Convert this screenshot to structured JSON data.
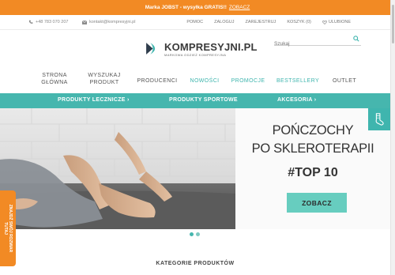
{
  "promo": {
    "text": "Marka JOBST - wysyłka GRATIS!!",
    "link": "ZOBACZ"
  },
  "util": {
    "phone": "+48 783 070 207",
    "email": "kontakt@kompresyjni.pl",
    "links": [
      "POMOC",
      "ZALOGUJ",
      "ZAREJESTRUJ",
      "KOSZYK (0)",
      "ULUBIONE"
    ]
  },
  "logo": {
    "name": "KOMPRESYJNI.PL",
    "tagline": "MARKOWA ODZIEŻ KOMPRESYJNA"
  },
  "search": {
    "placeholder": "Szukaj"
  },
  "nav": {
    "items": [
      {
        "line1": "STRONA",
        "line2": "GŁÓWNA"
      },
      {
        "line1": "WYSZUKAJ",
        "line2": "PRODUKT"
      },
      {
        "line1": "PRODUCENCI",
        "line2": ""
      },
      {
        "line1": "NOWOŚCI",
        "line2": ""
      },
      {
        "line1": "PROMOCJE",
        "line2": ""
      },
      {
        "line1": "BESTSELLERY",
        "line2": ""
      },
      {
        "line1": "OUTLET",
        "line2": ""
      }
    ],
    "accent": "#3fb5ae"
  },
  "subnav": {
    "items": [
      "PRODUKTY LECZNICZE ›",
      "PRODUKTY SPORTOWE",
      "AKCESORIA ›"
    ],
    "color": "#46b6ae"
  },
  "hero": {
    "line1": "POŃCZOCHY",
    "line2": "PO SKLEROTERAPII",
    "tag": "#TOP 10",
    "button": "ZOBACZ",
    "button_color": "#67cdbf"
  },
  "sidetab": {
    "line1": "ZNAJDŹ SWÓJ ROZMIAR",
    "line2": "TUTAJ"
  },
  "section": {
    "title": "KATEGORIE PRODUKTÓW"
  },
  "colors": {
    "orange": "#f28a24",
    "teal": "#46b6ae"
  }
}
